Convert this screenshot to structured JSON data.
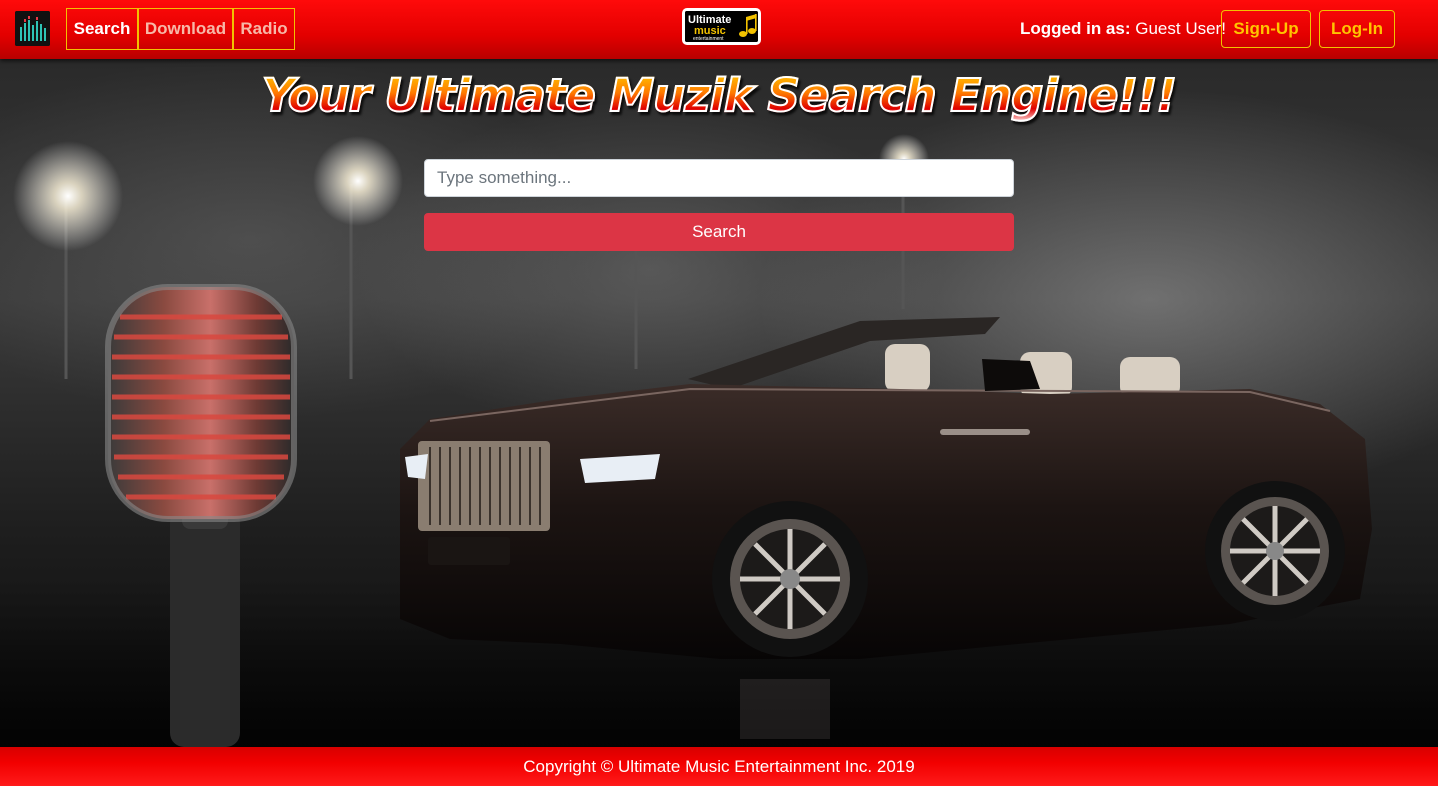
{
  "nav": {
    "brand_icon": "equalizer-icon",
    "links": [
      {
        "label": "Search",
        "active": true
      },
      {
        "label": "Download",
        "active": false
      },
      {
        "label": "Radio",
        "active": false
      }
    ],
    "logo": {
      "line1": "Ultimate",
      "line2": "music",
      "line3": "entertainment"
    },
    "logged_in_label": "Logged in as:",
    "user_name": "Guest User!",
    "signup_label": "Sign-Up",
    "login_label": "Log-In"
  },
  "hero": {
    "headline": "Your Ultimate Muzik Search Engine!!!",
    "search_placeholder": "Type something...",
    "search_button_label": "Search"
  },
  "footer": {
    "copyright": "Copyright © Ultimate Music Entertainment Inc. 2019"
  },
  "colors": {
    "nav_red": "#e30000",
    "accent_gold": "#f2c200",
    "search_button": "#dc3545"
  }
}
